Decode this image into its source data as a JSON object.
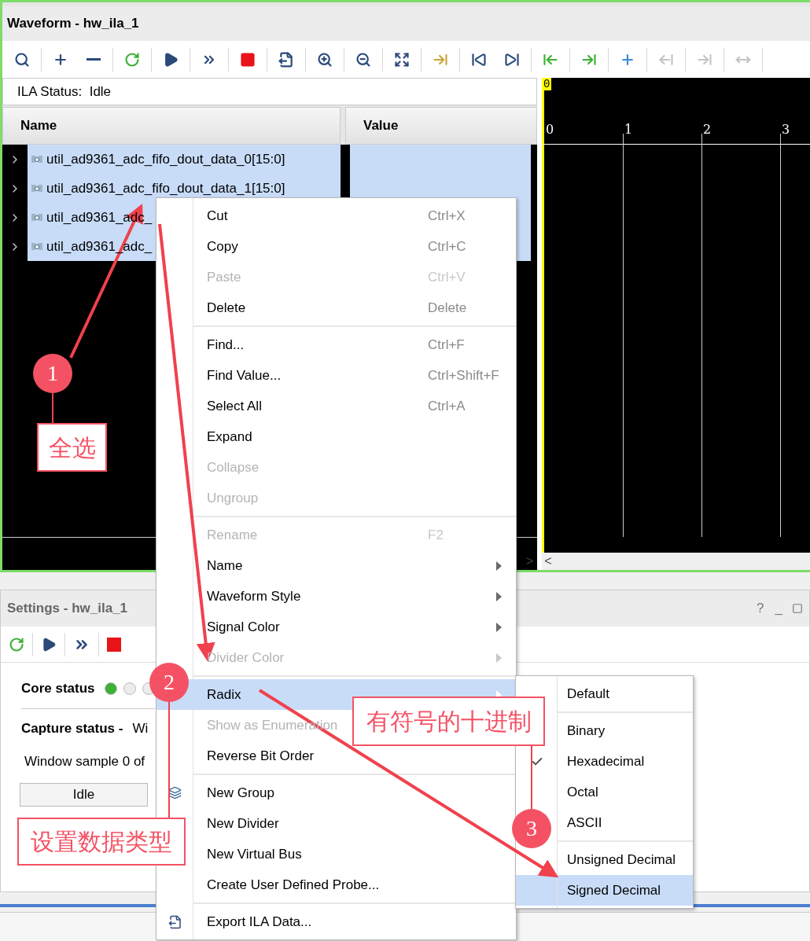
{
  "waveform_window": {
    "title": "Waveform - hw_ila_1",
    "toolbar": [
      {
        "disabled": false
      },
      {
        "disabled": false
      },
      {
        "disabled": false
      },
      {
        "disabled": false
      },
      {
        "disabled": false
      },
      {
        "disabled": false
      },
      {
        "disabled": false
      },
      {
        "disabled": false
      },
      {
        "disabled": false
      },
      {
        "disabled": false
      },
      {
        "disabled": false
      },
      {
        "disabled": false
      },
      {
        "disabled": false
      },
      {
        "disabled": false
      },
      {
        "disabled": false
      },
      {
        "disabled": false
      },
      {
        "disabled": false
      },
      {
        "disabled": true
      },
      {
        "disabled": true
      },
      {
        "disabled": true
      }
    ],
    "ila_status": "ILA Status:  Idle",
    "columns": [
      "Name",
      "Value"
    ],
    "rows": [
      {
        "name": "util_ad9361_adc_fifo_dout_data_0[15:0]",
        "selected": true
      },
      {
        "name": "util_ad9361_adc_fifo_dout_data_1[15:0]",
        "selected": true
      },
      {
        "name": "util_ad9361_adc_",
        "selected": true
      },
      {
        "name": "util_ad9361_adc_",
        "selected": true
      }
    ],
    "cursor_label": "0",
    "time_ticks": [
      "0",
      "1",
      "2",
      "3"
    ],
    "scroll_arrows": [
      ">",
      "<"
    ]
  },
  "settings_window": {
    "title": "Settings - hw_ila_1",
    "title_buttons": [
      "?",
      "_"
    ],
    "core_status": {
      "label": "Core status",
      "dots": [
        {
          "color": "#3cb034"
        },
        {
          "color": "#ececec"
        },
        {
          "color": "#ececec"
        }
      ]
    },
    "capture_status": {
      "label": "Capture status -",
      "value": "Wi"
    },
    "window_sample": "Window sample 0 of",
    "state_button": "Idle"
  },
  "context_menu": [
    {
      "kind": "item",
      "label": "Cut",
      "shortcut": "Ctrl+X",
      "disabled": false
    },
    {
      "kind": "item",
      "label": "Copy",
      "shortcut": "Ctrl+C",
      "disabled": false
    },
    {
      "kind": "item",
      "label": "Paste",
      "shortcut": "Ctrl+V",
      "disabled": true
    },
    {
      "kind": "item",
      "label": "Delete",
      "shortcut": "Delete",
      "disabled": false
    },
    {
      "kind": "separator"
    },
    {
      "kind": "item",
      "label": "Find...",
      "shortcut": "Ctrl+F",
      "disabled": false
    },
    {
      "kind": "item",
      "label": "Find Value...",
      "shortcut": "Ctrl+Shift+F",
      "disabled": false
    },
    {
      "kind": "item",
      "label": "Select All",
      "shortcut": "Ctrl+A",
      "disabled": false
    },
    {
      "kind": "item",
      "label": "Expand",
      "disabled": false
    },
    {
      "kind": "item",
      "label": "Collapse",
      "disabled": true
    },
    {
      "kind": "item",
      "label": "Ungroup",
      "disabled": true
    },
    {
      "kind": "separator"
    },
    {
      "kind": "item",
      "label": "Rename",
      "shortcut": "F2",
      "disabled": true
    },
    {
      "kind": "submenu",
      "label": "Name",
      "disabled": false
    },
    {
      "kind": "submenu",
      "label": "Waveform Style",
      "disabled": false
    },
    {
      "kind": "submenu",
      "label": "Signal Color",
      "disabled": false
    },
    {
      "kind": "submenu",
      "label": "Divider Color",
      "disabled": true
    },
    {
      "kind": "separator"
    },
    {
      "kind": "submenu",
      "label": "Radix",
      "disabled": false,
      "selected": true
    },
    {
      "kind": "item",
      "label": "Show as Enumeration",
      "disabled": true
    },
    {
      "kind": "item",
      "label": "Reverse Bit Order",
      "disabled": false
    },
    {
      "kind": "separator"
    },
    {
      "kind": "item",
      "label": "New Group",
      "disabled": false
    },
    {
      "kind": "item",
      "label": "New Divider",
      "disabled": false
    },
    {
      "kind": "item",
      "label": "New Virtual Bus",
      "disabled": false
    },
    {
      "kind": "item",
      "label": "Create User Defined Probe...",
      "disabled": false
    },
    {
      "kind": "separator"
    },
    {
      "kind": "item",
      "label": "Export ILA Data...",
      "disabled": false
    }
  ],
  "radix_submenu": [
    {
      "kind": "item",
      "label": "Default",
      "checked": false,
      "selected": false
    },
    {
      "kind": "separator"
    },
    {
      "kind": "item",
      "label": "Binary",
      "selected": false
    },
    {
      "kind": "item",
      "label": "Hexadecimal",
      "checked": true,
      "selected": false
    },
    {
      "kind": "item",
      "label": "Octal",
      "checked": false,
      "selected": false
    },
    {
      "kind": "item",
      "label": "ASCII",
      "selected": false
    },
    {
      "kind": "separator"
    },
    {
      "kind": "item",
      "label": "Unsigned Decimal",
      "checked": false,
      "selected": false
    },
    {
      "kind": "item",
      "label": "Signed Decimal",
      "checked": false,
      "selected": true
    }
  ],
  "callouts": [
    {
      "number": "1",
      "label": "全选"
    },
    {
      "number": "2",
      "label": "设置数据类型"
    },
    {
      "number": "3",
      "label": "有符号的十进制"
    }
  ]
}
